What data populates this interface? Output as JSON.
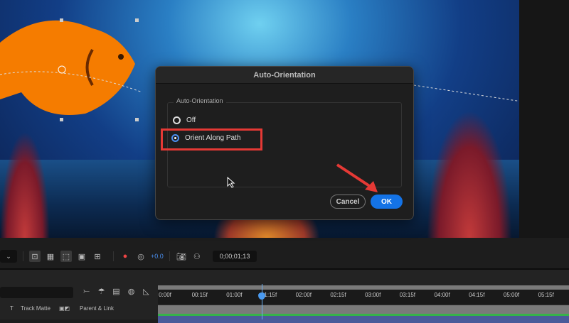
{
  "dialog": {
    "title": "Auto-Orientation",
    "group_label": "Auto-Orientation",
    "options": [
      {
        "label": "Off",
        "selected": false
      },
      {
        "label": "Orient Along Path",
        "selected": true
      }
    ],
    "cancel": "Cancel",
    "ok": "OK"
  },
  "toolbar": {
    "exposure": "+0.0",
    "timecode": "0;00;01;13"
  },
  "timeline": {
    "ticks": [
      "0:00f",
      "00:15f",
      "01:00f",
      "01:15f",
      "02:00f",
      "02:15f",
      "03:00f",
      "03:15f",
      "04:00f",
      "04:15f",
      "05:00f",
      "05:15f"
    ],
    "col_t": "T",
    "col_track_matte": "Track Matte",
    "col_parent": "Parent & Link"
  },
  "colors": {
    "accent": "#1473e6",
    "highlight": "#e53935",
    "fish": "#f57c00"
  }
}
